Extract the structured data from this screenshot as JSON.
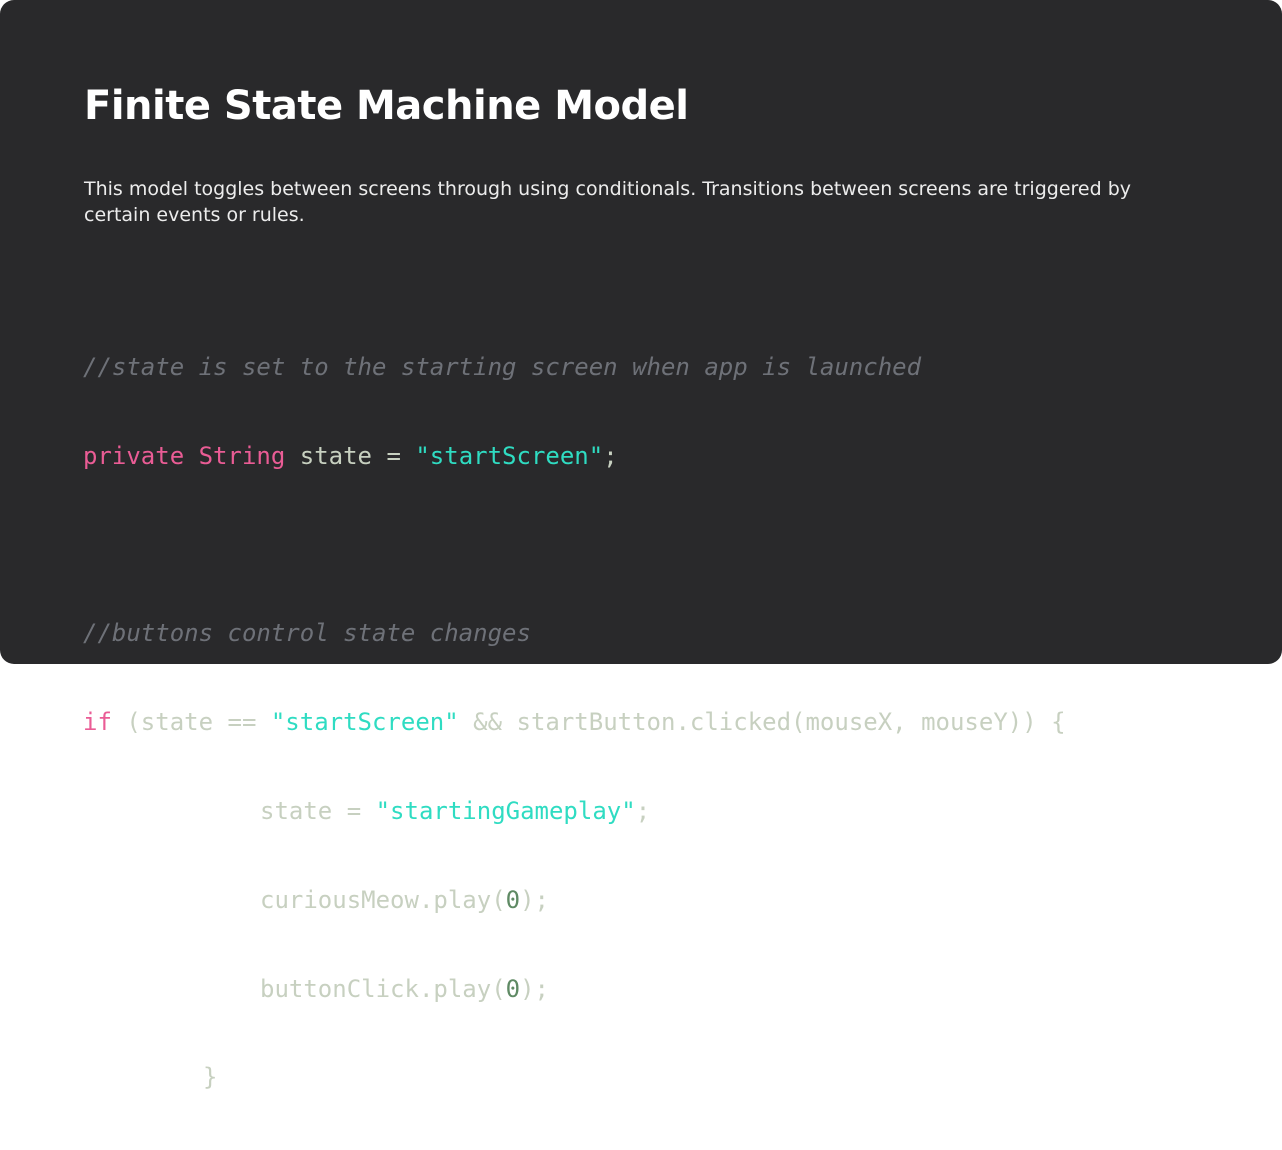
{
  "title": "Finite State Machine Model",
  "description": "This model toggles between screens through using conditionals. Transitions between screens are triggered by certain events or rules.",
  "code": {
    "comment_1": "//state is set to the starting screen when app is launched",
    "l2_kw_private": "private",
    "l2_sp1": " ",
    "l2_kw_type": "String",
    "l2_mid": " state = ",
    "l2_str": "\"startScreen\"",
    "l2_end": ";",
    "comment_2": "//buttons control state changes",
    "l5_kw_if": "if",
    "l5_mid1": " (state == ",
    "l5_str": "\"startScreen\"",
    "l5_mid2": " && startButton.clicked(mouseX, mouseY)) {",
    "l6_mid": "state = ",
    "l6_str": "\"startingGameplay\"",
    "l6_end": ";",
    "l7_pre": "curiousMeow.play(",
    "l7_num": "0",
    "l7_end": ");",
    "l8_pre": "buttonClick.play(",
    "l8_num": "0",
    "l8_end": ");",
    "l9_brace": "}"
  }
}
